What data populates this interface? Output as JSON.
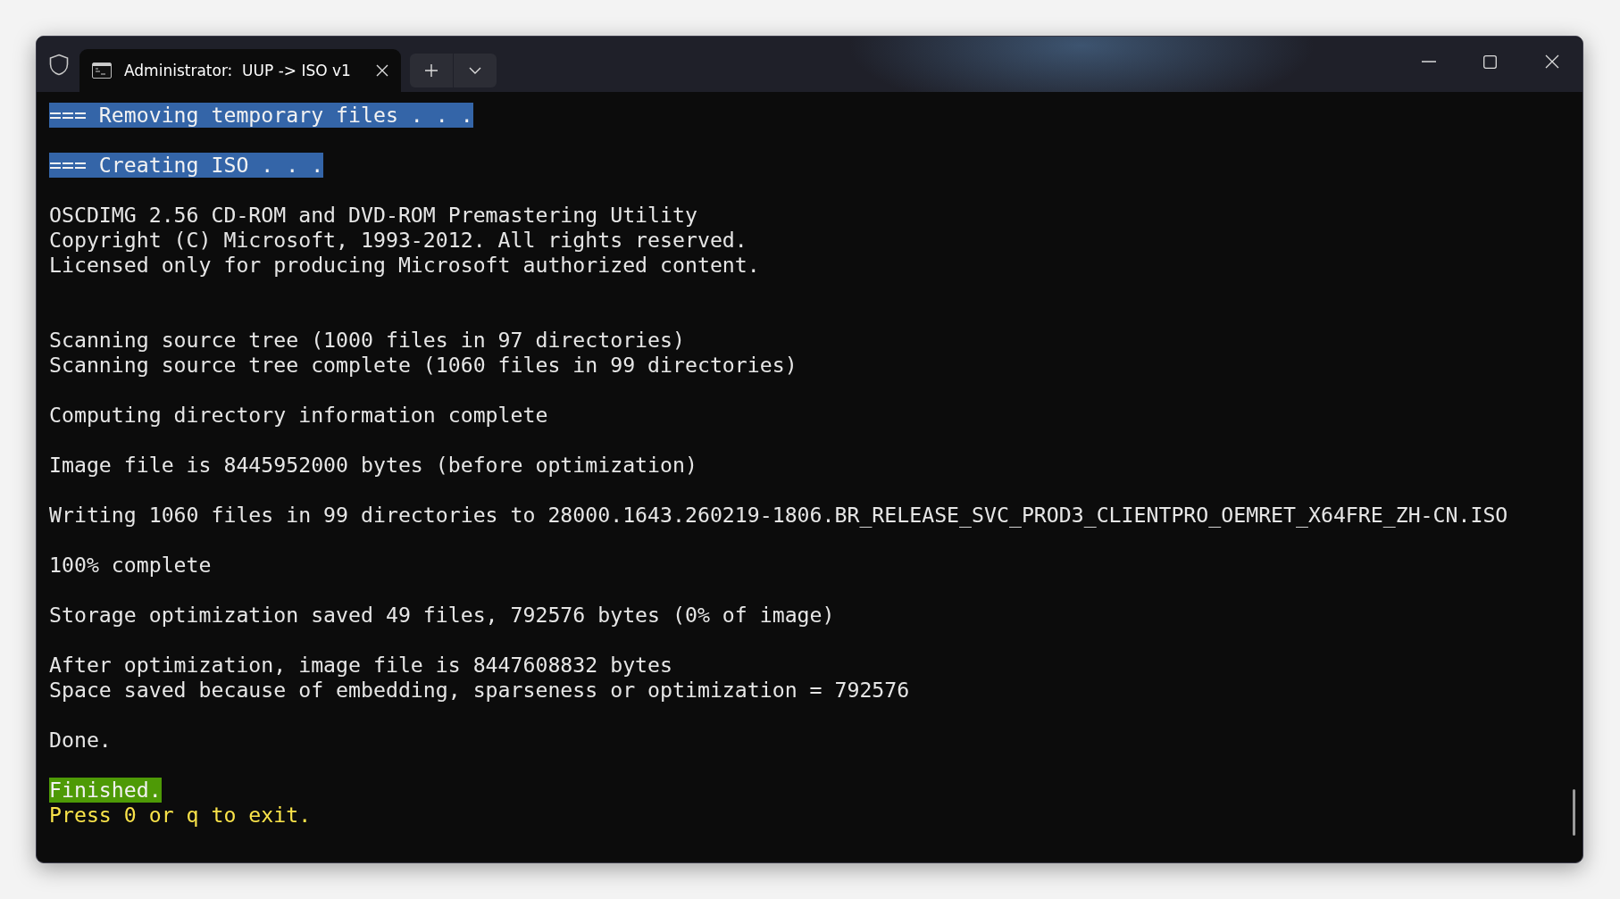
{
  "window": {
    "tab": {
      "title": "Administrator:  UUP -> ISO v1",
      "selected": true
    }
  },
  "terminal": {
    "lines": [
      {
        "kind": "highlight",
        "text": "=== Removing temporary files . . ."
      },
      {
        "kind": "blank"
      },
      {
        "kind": "highlight",
        "text": "=== Creating ISO . . ."
      },
      {
        "kind": "blank"
      },
      {
        "kind": "plain",
        "text": "OSCDIMG 2.56 CD-ROM and DVD-ROM Premastering Utility"
      },
      {
        "kind": "plain",
        "text": "Copyright (C) Microsoft, 1993-2012. All rights reserved."
      },
      {
        "kind": "plain",
        "text": "Licensed only for producing Microsoft authorized content."
      },
      {
        "kind": "blank"
      },
      {
        "kind": "blank"
      },
      {
        "kind": "plain",
        "text": "Scanning source tree (1000 files in 97 directories)"
      },
      {
        "kind": "plain",
        "text": "Scanning source tree complete (1060 files in 99 directories)"
      },
      {
        "kind": "blank"
      },
      {
        "kind": "plain",
        "text": "Computing directory information complete"
      },
      {
        "kind": "blank"
      },
      {
        "kind": "plain",
        "text": "Image file is 8445952000 bytes (before optimization)"
      },
      {
        "kind": "blank"
      },
      {
        "kind": "plain",
        "text": "Writing 1060 files in 99 directories to 28000.1643.260219-1806.BR_RELEASE_SVC_PROD3_CLIENTPRO_OEMRET_X64FRE_ZH-CN.ISO"
      },
      {
        "kind": "blank"
      },
      {
        "kind": "plain",
        "text": "100% complete"
      },
      {
        "kind": "blank"
      },
      {
        "kind": "plain",
        "text": "Storage optimization saved 49 files, 792576 bytes (0% of image)"
      },
      {
        "kind": "blank"
      },
      {
        "kind": "plain",
        "text": "After optimization, image file is 8447608832 bytes"
      },
      {
        "kind": "plain",
        "text": "Space saved because of embedding, sparseness or optimization = 792576"
      },
      {
        "kind": "blank"
      },
      {
        "kind": "plain",
        "text": "Done."
      },
      {
        "kind": "blank"
      },
      {
        "kind": "success",
        "text": "Finished."
      },
      {
        "kind": "prompt",
        "text": "Press 0 or q to exit."
      }
    ]
  }
}
